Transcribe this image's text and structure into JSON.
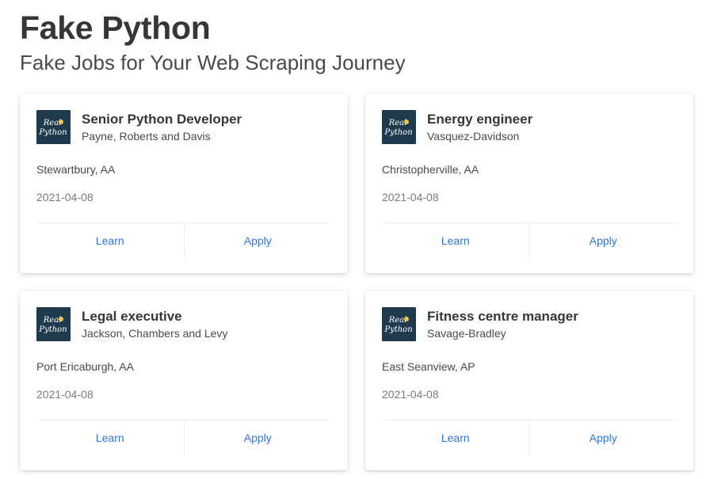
{
  "header": {
    "title": "Fake Python",
    "subtitle": "Fake Jobs for Your Web Scraping Journey"
  },
  "logo": {
    "text_line1": "Real",
    "text_line2": "Python",
    "background_color": "#1f3a4d",
    "accent_color": "#f2c94c"
  },
  "jobs": [
    {
      "title": "Senior Python Developer",
      "company": "Payne, Roberts and Davis",
      "location": "Stewartbury, AA",
      "date": "2021-04-08",
      "learn_label": "Learn",
      "apply_label": "Apply"
    },
    {
      "title": "Energy engineer",
      "company": "Vasquez-Davidson",
      "location": "Christopherville, AA",
      "date": "2021-04-08",
      "learn_label": "Learn",
      "apply_label": "Apply"
    },
    {
      "title": "Legal executive",
      "company": "Jackson, Chambers and Levy",
      "location": "Port Ericaburgh, AA",
      "date": "2021-04-08",
      "learn_label": "Learn",
      "apply_label": "Apply"
    },
    {
      "title": "Fitness centre manager",
      "company": "Savage-Bradley",
      "location": "East Seanview, AP",
      "date": "2021-04-08",
      "learn_label": "Learn",
      "apply_label": "Apply"
    }
  ],
  "colors": {
    "link": "#3273dc",
    "title": "#363636",
    "muted": "#7a7a7a"
  }
}
